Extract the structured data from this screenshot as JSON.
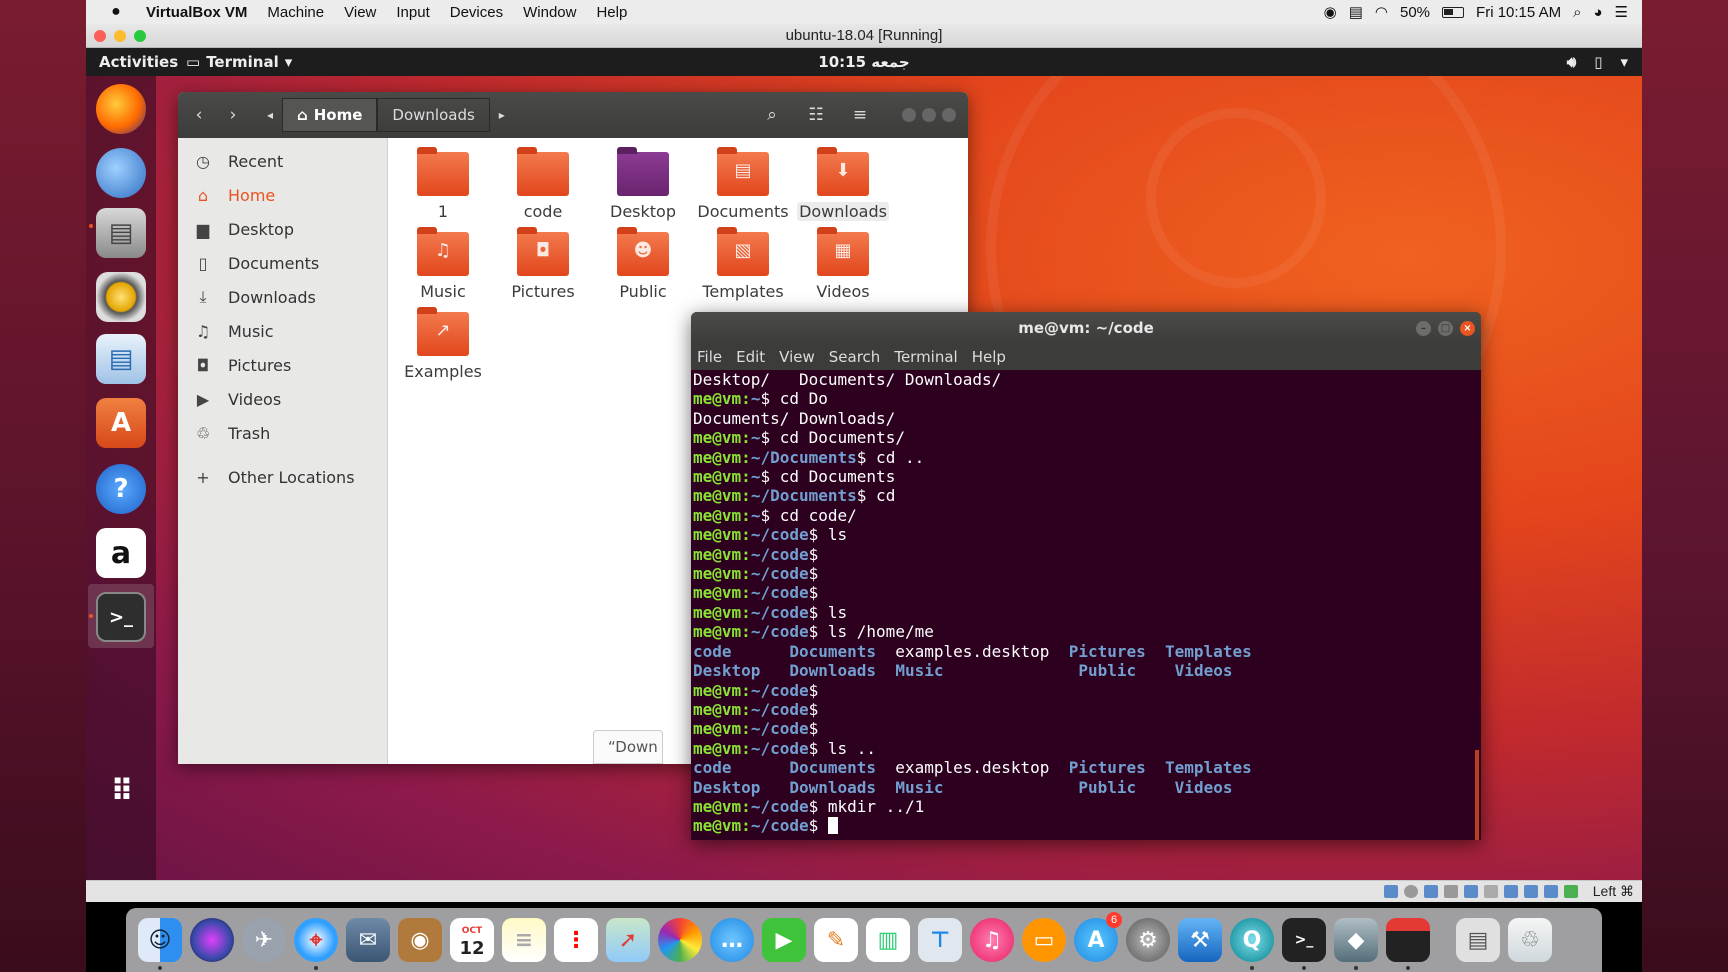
{
  "mac_menubar": {
    "app": "VirtualBox VM",
    "items": [
      "Machine",
      "View",
      "Input",
      "Devices",
      "Window",
      "Help"
    ],
    "battery": "50%",
    "clock": "Fri 10:15 AM"
  },
  "vbox": {
    "title": "ubuntu-18.04 [Running]",
    "host_key": "Left ⌘"
  },
  "gnome": {
    "activities": "Activities",
    "app_menu": "Terminal",
    "clock": "جمعه 10:15"
  },
  "files": {
    "path_home": "Home",
    "path_current": "Downloads",
    "sidebar": [
      {
        "label": "Recent",
        "icon": "clock-icon"
      },
      {
        "label": "Home",
        "icon": "home-icon"
      },
      {
        "label": "Desktop",
        "icon": "desktop-icon"
      },
      {
        "label": "Documents",
        "icon": "document-icon"
      },
      {
        "label": "Downloads",
        "icon": "download-icon"
      },
      {
        "label": "Music",
        "icon": "music-icon"
      },
      {
        "label": "Pictures",
        "icon": "camera-icon"
      },
      {
        "label": "Videos",
        "icon": "video-icon"
      },
      {
        "label": "Trash",
        "icon": "trash-icon"
      },
      {
        "label": "Other Locations",
        "icon": "plus-icon"
      }
    ],
    "folders": [
      "1",
      "code",
      "Desktop",
      "Documents",
      "Downloads",
      "Music",
      "Pictures",
      "Public",
      "Templates",
      "Videos",
      "Examples"
    ],
    "status_box": "“Down"
  },
  "terminal": {
    "title": "me@vm: ~/code",
    "menu": [
      "File",
      "Edit",
      "View",
      "Search",
      "Terminal",
      "Help"
    ],
    "prompt_user": "me@vm",
    "lines": {
      "l1": "Desktop/   Documents/ Downloads/",
      "l3": "Documents/ Downloads/",
      "cmd2": " cd Do",
      "cmd4": " cd Documents/",
      "cmd5": " cd ..",
      "cmd6": " cd Documents",
      "cmd7": " cd",
      "cmd8": " cd code/",
      "cmd9": " ls",
      "cmd13": " ls",
      "cmd14": " ls /home/me",
      "cmd20": " ls ..",
      "cmd23": " mkdir ../1"
    },
    "ls_row1": [
      "code",
      "Documents",
      "examples.desktop",
      "Pictures",
      "Templates"
    ],
    "ls_row2": [
      "Desktop",
      "Downloads",
      "Music",
      "",
      "Public",
      "Videos"
    ],
    "path_home": "~",
    "path_docs": "~/Documents",
    "path_code": "~/code"
  },
  "mac_dock": {
    "calendar_month": "OCT",
    "calendar_day": "12",
    "appstore_badge": "6"
  }
}
